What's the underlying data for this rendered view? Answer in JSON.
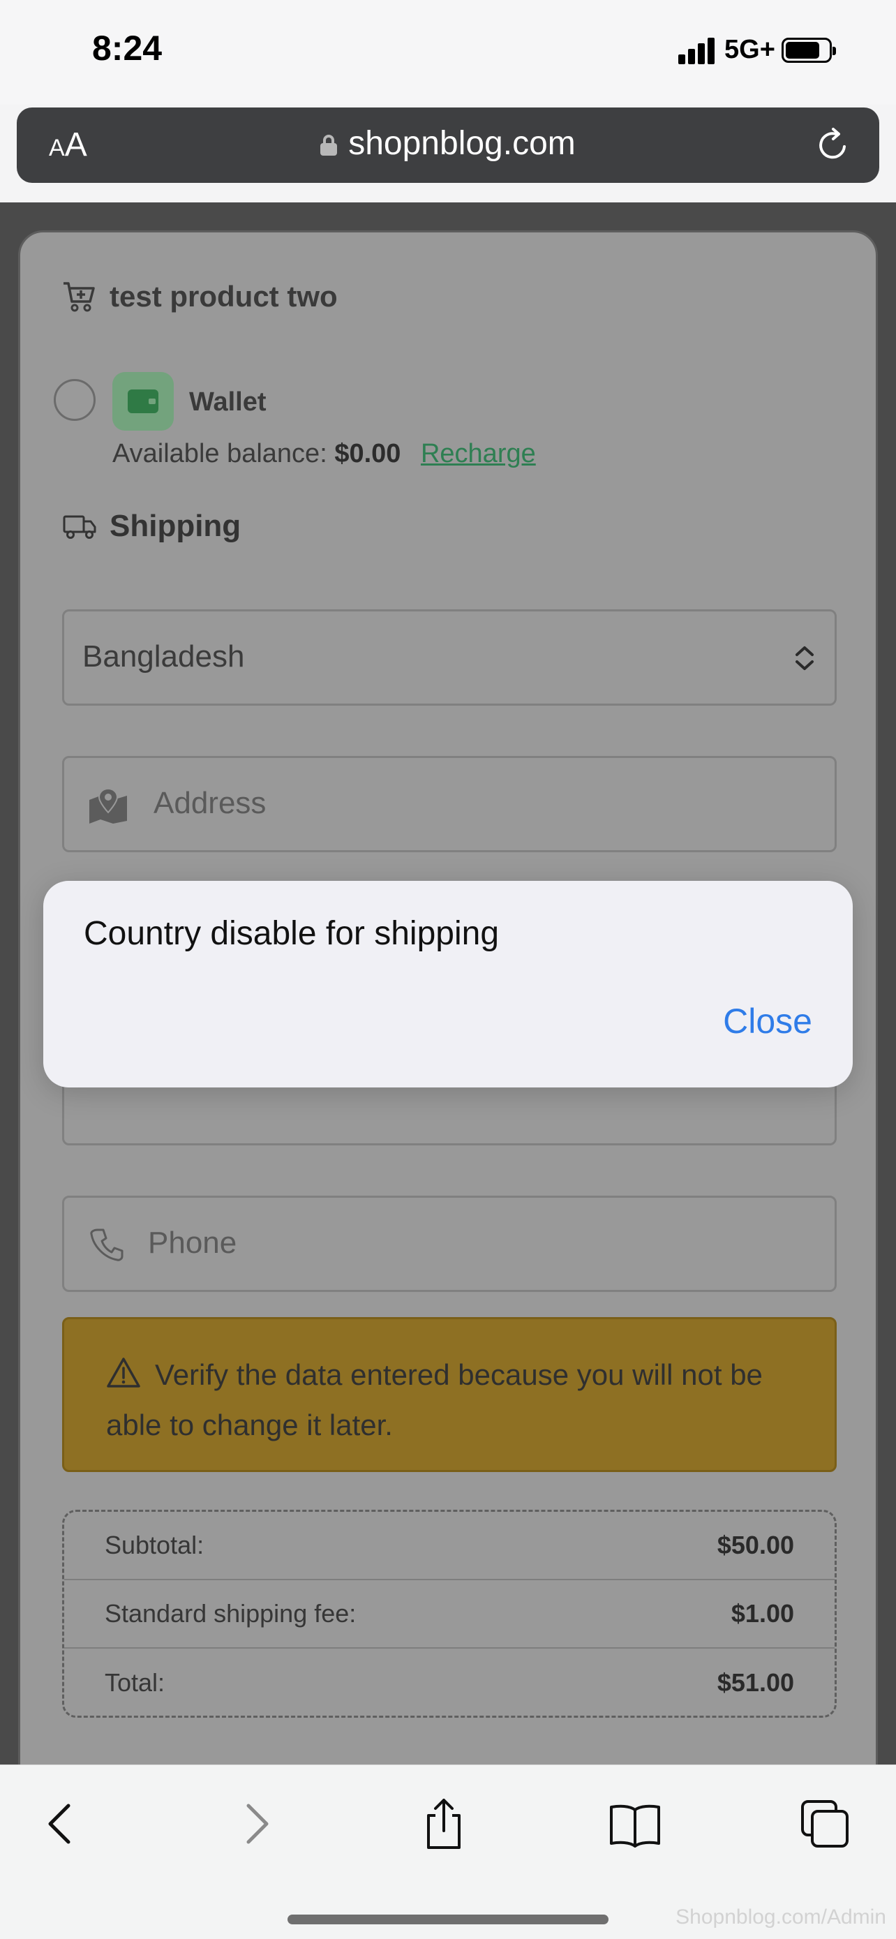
{
  "status_bar": {
    "time": "8:24",
    "network": "5G+"
  },
  "browser": {
    "text_size_small": "A",
    "text_size_big": "A",
    "url": "shopnblog.com"
  },
  "product": {
    "title": "test product two"
  },
  "payment": {
    "wallet_label": "Wallet",
    "balance_label": "Available balance:",
    "balance_value": "$0.00",
    "recharge_link": "Recharge"
  },
  "shipping": {
    "title": "Shipping",
    "country_value": "Bangladesh",
    "address_placeholder": "Address",
    "phone_placeholder": "Phone"
  },
  "warning": {
    "text": "Verify the data entered because you will not be able to change it later."
  },
  "summary": {
    "rows": [
      {
        "label": "Subtotal:",
        "value": "$50.00"
      },
      {
        "label": "Standard shipping fee:",
        "value": "$1.00"
      },
      {
        "label": "Total:",
        "value": "$51.00"
      }
    ]
  },
  "alert": {
    "message": "Country disable for shipping",
    "close_label": "Close"
  },
  "watermark": "Shopnblog.com/Admin"
}
